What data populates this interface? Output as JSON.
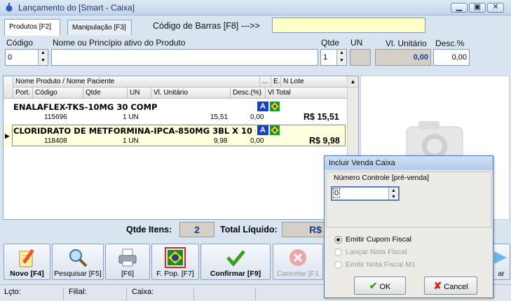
{
  "window": {
    "title": "Lançamento do [Smart - Caixa]"
  },
  "tabs": [
    "Produtos [F2]",
    "Manipulação [F3]"
  ],
  "barcode": {
    "label": "Código de Barras [F8] --->>",
    "value": ""
  },
  "labels": {
    "codigo": "Código",
    "nome": "Nome ou Princípio ativo do Produto",
    "qtde": "Qtde",
    "un": "UN",
    "vl_unitario": "Vl. Unitário",
    "desc": "Desc.%"
  },
  "entry": {
    "codigo": "0",
    "nome": "",
    "qtde": "1",
    "un": "",
    "vl_unitario": "0,00",
    "desc": "0,00"
  },
  "grid": {
    "header_row1": [
      "Nome Produto / Nome Paciente",
      "...",
      "E.",
      "N Lote"
    ],
    "header_row2": [
      "Port.",
      "Código",
      "Qtde",
      "UN",
      "Vl. Unitário",
      "Desc.(%)",
      "Vl Total"
    ],
    "rows": [
      {
        "name": "ENALAFLEX-TKS-10MG 30 COMP",
        "codigo": "115696",
        "qtde": "1 UN",
        "vl_unitario": "15,51",
        "desc": "0,00",
        "total": "R$ 15,51",
        "badge": "A"
      },
      {
        "name": "CLORIDRATO DE METFORMINA-IPCA-850MG 3BL X 10 C",
        "codigo": "118408",
        "qtde": "1 UN",
        "vl_unitario": "9,98",
        "desc": "0,00",
        "total": "R$ 9,98",
        "badge": "A"
      }
    ]
  },
  "totals": {
    "qtde_label": "Qtde Itens:",
    "qtde_value": "2",
    "liquido_label": "Total Líquido:",
    "liquido_value": "R$"
  },
  "toolbar": [
    {
      "label": "Novo [F4]"
    },
    {
      "label": "Pesquisar [F5]"
    },
    {
      "label": "[F6]"
    },
    {
      "label": "F. Pop. [F7]"
    },
    {
      "label": "Confirmar [F9]"
    },
    {
      "label": "Cancelar [F1"
    },
    {
      "label": "ar"
    }
  ],
  "statusbar": {
    "lcto": "Lçto:",
    "filial": "Filial:",
    "caixa": "Caixa:"
  },
  "dialog": {
    "title": "Incluir Venda Caixa",
    "group_label": "Número Controle [pré-venda]",
    "numero_controle": "0",
    "options": [
      "Emitir Cupom Fiscal",
      "Lançar Nota Fiscal",
      "Emitir Nota Fiscal M1"
    ],
    "ok_label": "OK",
    "cancel_label": "Cancel"
  },
  "colors": {
    "accent_blue": "#1a3fc8",
    "confirm_green": "#3ca11e",
    "cancel_red": "#c8221f",
    "total_blue": "#1a3d8f"
  }
}
